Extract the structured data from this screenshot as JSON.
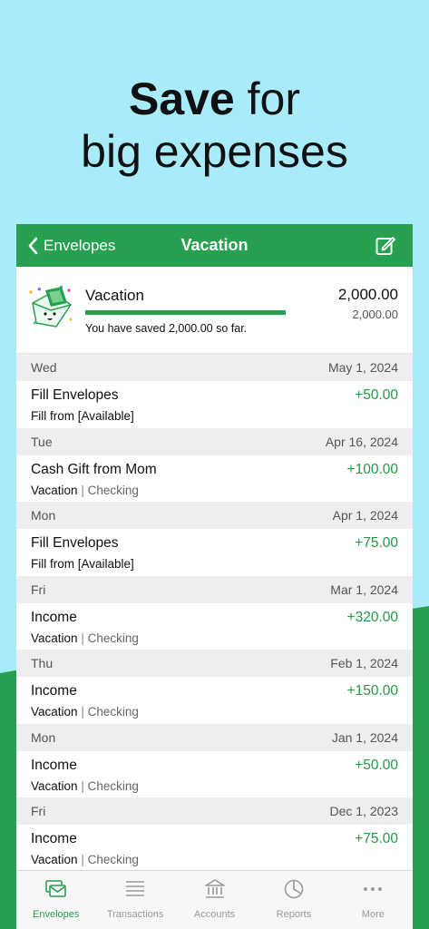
{
  "headline": {
    "bold": "Save",
    "line1_rest": "for",
    "line2": "big expenses"
  },
  "navbar": {
    "back_label": "Envelopes",
    "title": "Vacation"
  },
  "summary": {
    "name": "Vacation",
    "amount": "2,000.00",
    "target": "2,000.00",
    "saved_text": "You have saved 2,000.00 so far.",
    "progress": 1.0
  },
  "groups": [
    {
      "day": "Wed",
      "date": "May 1, 2024",
      "title": "Fill Envelopes",
      "amount": "+50.00",
      "sub": "Fill from [Available]",
      "account": ""
    },
    {
      "day": "Tue",
      "date": "Apr 16, 2024",
      "title": "Cash Gift from Mom",
      "amount": "+100.00",
      "sub": "Vacation",
      "account": "Checking"
    },
    {
      "day": "Mon",
      "date": "Apr 1, 2024",
      "title": "Fill Envelopes",
      "amount": "+75.00",
      "sub": "Fill from [Available]",
      "account": ""
    },
    {
      "day": "Fri",
      "date": "Mar 1, 2024",
      "title": "Income",
      "amount": "+320.00",
      "sub": "Vacation",
      "account": "Checking"
    },
    {
      "day": "Thu",
      "date": "Feb 1, 2024",
      "title": "Income",
      "amount": "+150.00",
      "sub": "Vacation",
      "account": "Checking"
    },
    {
      "day": "Mon",
      "date": "Jan 1, 2024",
      "title": "Income",
      "amount": "+50.00",
      "sub": "Vacation",
      "account": "Checking"
    },
    {
      "day": "Fri",
      "date": "Dec 1, 2023",
      "title": "Income",
      "amount": "+75.00",
      "sub": "Vacation",
      "account": "Checking"
    }
  ],
  "separator": "|",
  "tabs": [
    {
      "label": "Envelopes",
      "icon": "envelopes-icon",
      "active": true
    },
    {
      "label": "Transactions",
      "icon": "transactions-icon",
      "active": false
    },
    {
      "label": "Accounts",
      "icon": "bank-icon",
      "active": false
    },
    {
      "label": "Reports",
      "icon": "pie-chart-icon",
      "active": false
    },
    {
      "label": "More",
      "icon": "more-icon",
      "active": false
    }
  ],
  "colors": {
    "brand_green": "#27a14f",
    "amount_green": "#1f9a45",
    "sky": "#a8ecfb"
  }
}
